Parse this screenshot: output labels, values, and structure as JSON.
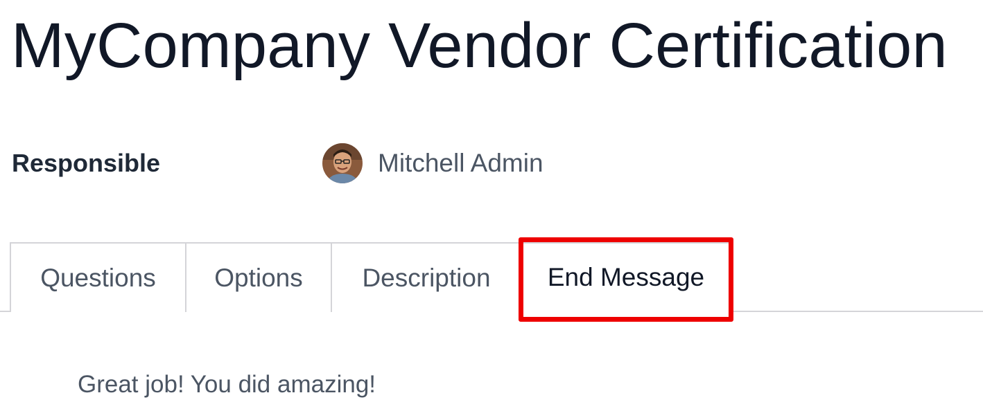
{
  "page": {
    "title": "MyCompany Vendor Certification"
  },
  "responsible": {
    "label": "Responsible",
    "user_name": "Mitchell Admin"
  },
  "tabs": [
    {
      "label": "Questions",
      "active": false
    },
    {
      "label": "Options",
      "active": false
    },
    {
      "label": "Description",
      "active": false
    },
    {
      "label": "End Message",
      "active": true
    }
  ],
  "end_message": {
    "text": "Great job! You did amazing!"
  },
  "colors": {
    "title": "#111827",
    "highlight": "#ee0000",
    "tab_border": "#d4d4d8",
    "muted_text": "#4b5563"
  }
}
